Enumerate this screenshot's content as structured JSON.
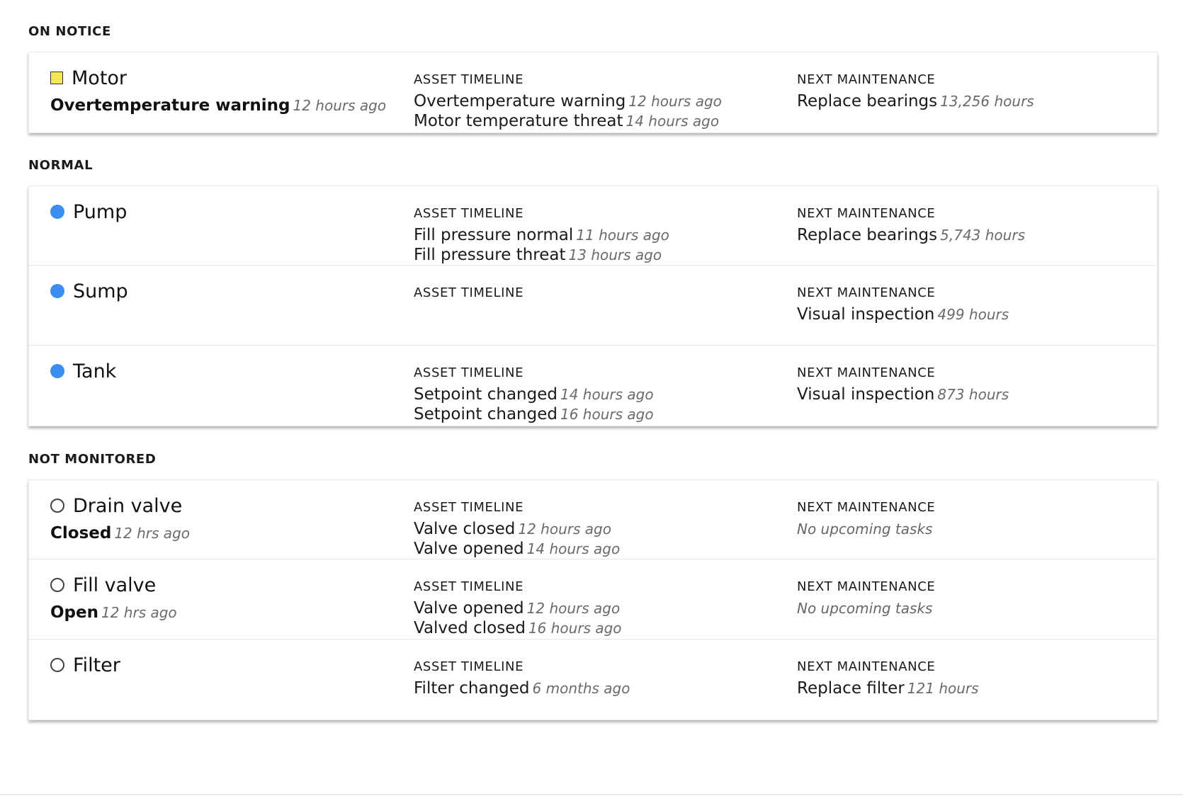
{
  "sections": [
    {
      "title": "ON NOTICE",
      "assets": [
        {
          "name": "Motor",
          "status_icon": "warning-square-icon",
          "status": {
            "label": "Overtemperature warning",
            "time": "12 hours ago"
          },
          "timeline_heading": "ASSET TIMELINE",
          "timeline": [
            {
              "text": "Overtemperature warning",
              "time": "12 hours ago"
            },
            {
              "text": "Motor temperature threat",
              "time": "14 hours ago"
            }
          ],
          "maintenance_heading": "NEXT MAINTENANCE",
          "maintenance": [
            {
              "text": "Replace bearings",
              "time": "13,256 hours"
            }
          ]
        }
      ]
    },
    {
      "title": "NORMAL",
      "assets": [
        {
          "name": "Pump",
          "status_icon": "normal-dot-icon",
          "timeline_heading": "ASSET TIMELINE",
          "timeline": [
            {
              "text": "Fill pressure normal",
              "time": "11 hours ago"
            },
            {
              "text": "Fill pressure threat",
              "time": "13 hours ago"
            }
          ],
          "maintenance_heading": "NEXT MAINTENANCE",
          "maintenance": [
            {
              "text": "Replace bearings",
              "time": "5,743 hours"
            }
          ]
        },
        {
          "name": "Sump",
          "status_icon": "normal-dot-icon",
          "timeline_heading": "ASSET TIMELINE",
          "timeline": [],
          "maintenance_heading": "NEXT MAINTENANCE",
          "maintenance": [
            {
              "text": "Visual inspection",
              "time": "499 hours"
            }
          ]
        },
        {
          "name": "Tank",
          "status_icon": "normal-dot-icon",
          "timeline_heading": "ASSET TIMELINE",
          "timeline": [
            {
              "text": "Setpoint changed",
              "time": "14 hours ago"
            },
            {
              "text": "Setpoint changed",
              "time": "16 hours ago"
            }
          ],
          "maintenance_heading": "NEXT MAINTENANCE",
          "maintenance": [
            {
              "text": "Visual inspection",
              "time": "873 hours"
            }
          ]
        }
      ]
    },
    {
      "title": "NOT MONITORED",
      "assets": [
        {
          "name": "Drain valve",
          "status_icon": "unmonitored-ring-icon",
          "status": {
            "label": "Closed",
            "time": "12 hrs ago"
          },
          "timeline_heading": "ASSET TIMELINE",
          "timeline": [
            {
              "text": "Valve closed",
              "time": "12 hours ago"
            },
            {
              "text": "Valve opened",
              "time": "14 hours ago"
            }
          ],
          "maintenance_heading": "NEXT MAINTENANCE",
          "maintenance": [],
          "maintenance_empty": "No upcoming tasks"
        },
        {
          "name": "Fill valve",
          "status_icon": "unmonitored-ring-icon",
          "status": {
            "label": "Open",
            "time": "12 hrs ago"
          },
          "timeline_heading": "ASSET TIMELINE",
          "timeline": [
            {
              "text": "Valve opened",
              "time": "12 hours ago"
            },
            {
              "text": "Valved closed",
              "time": "16 hours ago"
            }
          ],
          "maintenance_heading": "NEXT MAINTENANCE",
          "maintenance": [],
          "maintenance_empty": "No upcoming tasks"
        },
        {
          "name": "Filter",
          "status_icon": "unmonitored-ring-icon",
          "timeline_heading": "ASSET TIMELINE",
          "timeline": [
            {
              "text": "Filter changed",
              "time": "6 months ago"
            }
          ],
          "maintenance_heading": "NEXT MAINTENANCE",
          "maintenance": [
            {
              "text": "Replace filter",
              "time": "121 hours"
            }
          ]
        }
      ]
    }
  ],
  "colors": {
    "warning": "#f2e84d",
    "normal": "#3b8df0",
    "unmonitored": "#444444",
    "muted_text": "#6a6a6a"
  }
}
